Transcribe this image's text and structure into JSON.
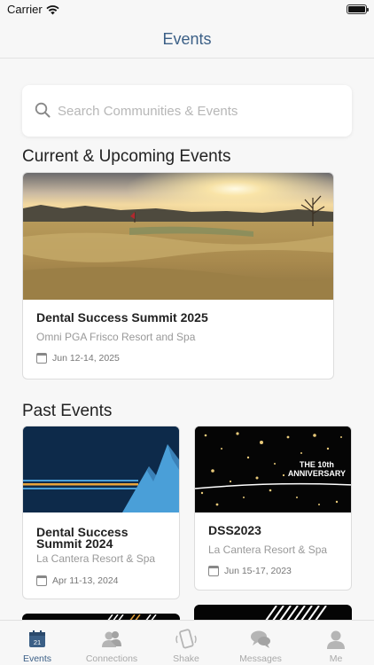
{
  "status_bar": {
    "carrier": "Carrier",
    "time": ""
  },
  "nav": {
    "title": "Events"
  },
  "search": {
    "placeholder": "Search Communities & Events"
  },
  "sections": {
    "current": "Current & Upcoming Events",
    "past": "Past Events"
  },
  "current_events": [
    {
      "name": "Dental Success Summit 2025",
      "venue": "Omni PGA Frisco Resort and Spa",
      "date": "Jun 12-14, 2025"
    }
  ],
  "past_events": [
    {
      "name": "Dental Success Summit 2024",
      "venue": "La Cantera Resort & Spa",
      "date": "Apr 11-13, 2024"
    },
    {
      "name": "DSS2023",
      "venue": "La Cantera Resort & Spa",
      "date": "Jun 15-17, 2023",
      "banner_text_1": "THE 10th",
      "banner_text_2": "ANNIVERSARY"
    }
  ],
  "tabs": [
    {
      "label": "Events",
      "icon": "calendar-icon",
      "active": true,
      "badge": "21"
    },
    {
      "label": "Connections",
      "icon": "people-icon",
      "active": false
    },
    {
      "label": "Shake",
      "icon": "phone-shake-icon",
      "active": false
    },
    {
      "label": "Messages",
      "icon": "chat-bubbles-icon",
      "active": false
    },
    {
      "label": "Me",
      "icon": "person-icon",
      "active": false
    }
  ],
  "colors": {
    "accent": "#3b5f86",
    "navy": "#0d2a4a",
    "mountain": "#4a9fd8",
    "stripe": "#e8a33a"
  }
}
